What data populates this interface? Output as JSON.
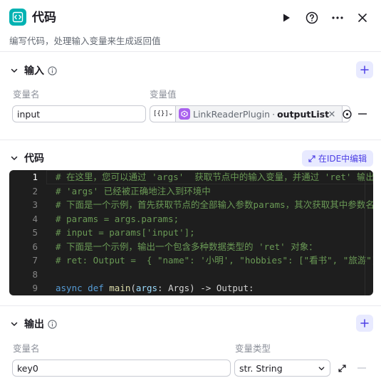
{
  "header": {
    "title": "代码",
    "subtitle": "编写代码，处理输入变量来生成返回值"
  },
  "input_section": {
    "title": "输入",
    "col_name": "变量名",
    "col_value": "变量值",
    "row": {
      "name": "input",
      "type_tag": "[{}]",
      "plugin": "LinkReaderPlugin",
      "separator": "·",
      "field": "outputList"
    }
  },
  "code_section": {
    "title": "代码",
    "ide_button": "在IDE中编辑",
    "line_numbers": [
      "1",
      "2",
      "3",
      "4",
      "5",
      "6",
      "7",
      "8",
      "9"
    ],
    "lines": [
      "# 在这里，您可以通过 'args'  获取节点中的输入变量，并通过 'ret' 输出结果",
      "# 'args' 已经被正确地注入到环境中",
      "# 下面是一个示例，首先获取节点的全部输入参数params，其次获取其中参数名为'input'的值：",
      "# params = args.params;",
      "# input = params['input'];",
      "# 下面是一个示例，输出一个包含多种数据类型的 'ret' 对象：",
      "# ret: Output =  { \"name\": '小明', \"hobbies\": [\"看书\", \"旅游\"] };",
      "",
      ""
    ],
    "line9": {
      "kw1": "async",
      "kw2": "def",
      "fn": "main",
      "rest1": "(",
      "param": "args",
      "rest2": ": Args) -> Output:"
    }
  },
  "output_section": {
    "title": "输出",
    "col_name": "变量名",
    "col_type": "变量类型",
    "row": {
      "name": "key0",
      "type": "str. String"
    }
  },
  "colors": {
    "accent": "#4e40e5",
    "logo": "#00b2b2",
    "plugin_icon": "#a962ee"
  }
}
